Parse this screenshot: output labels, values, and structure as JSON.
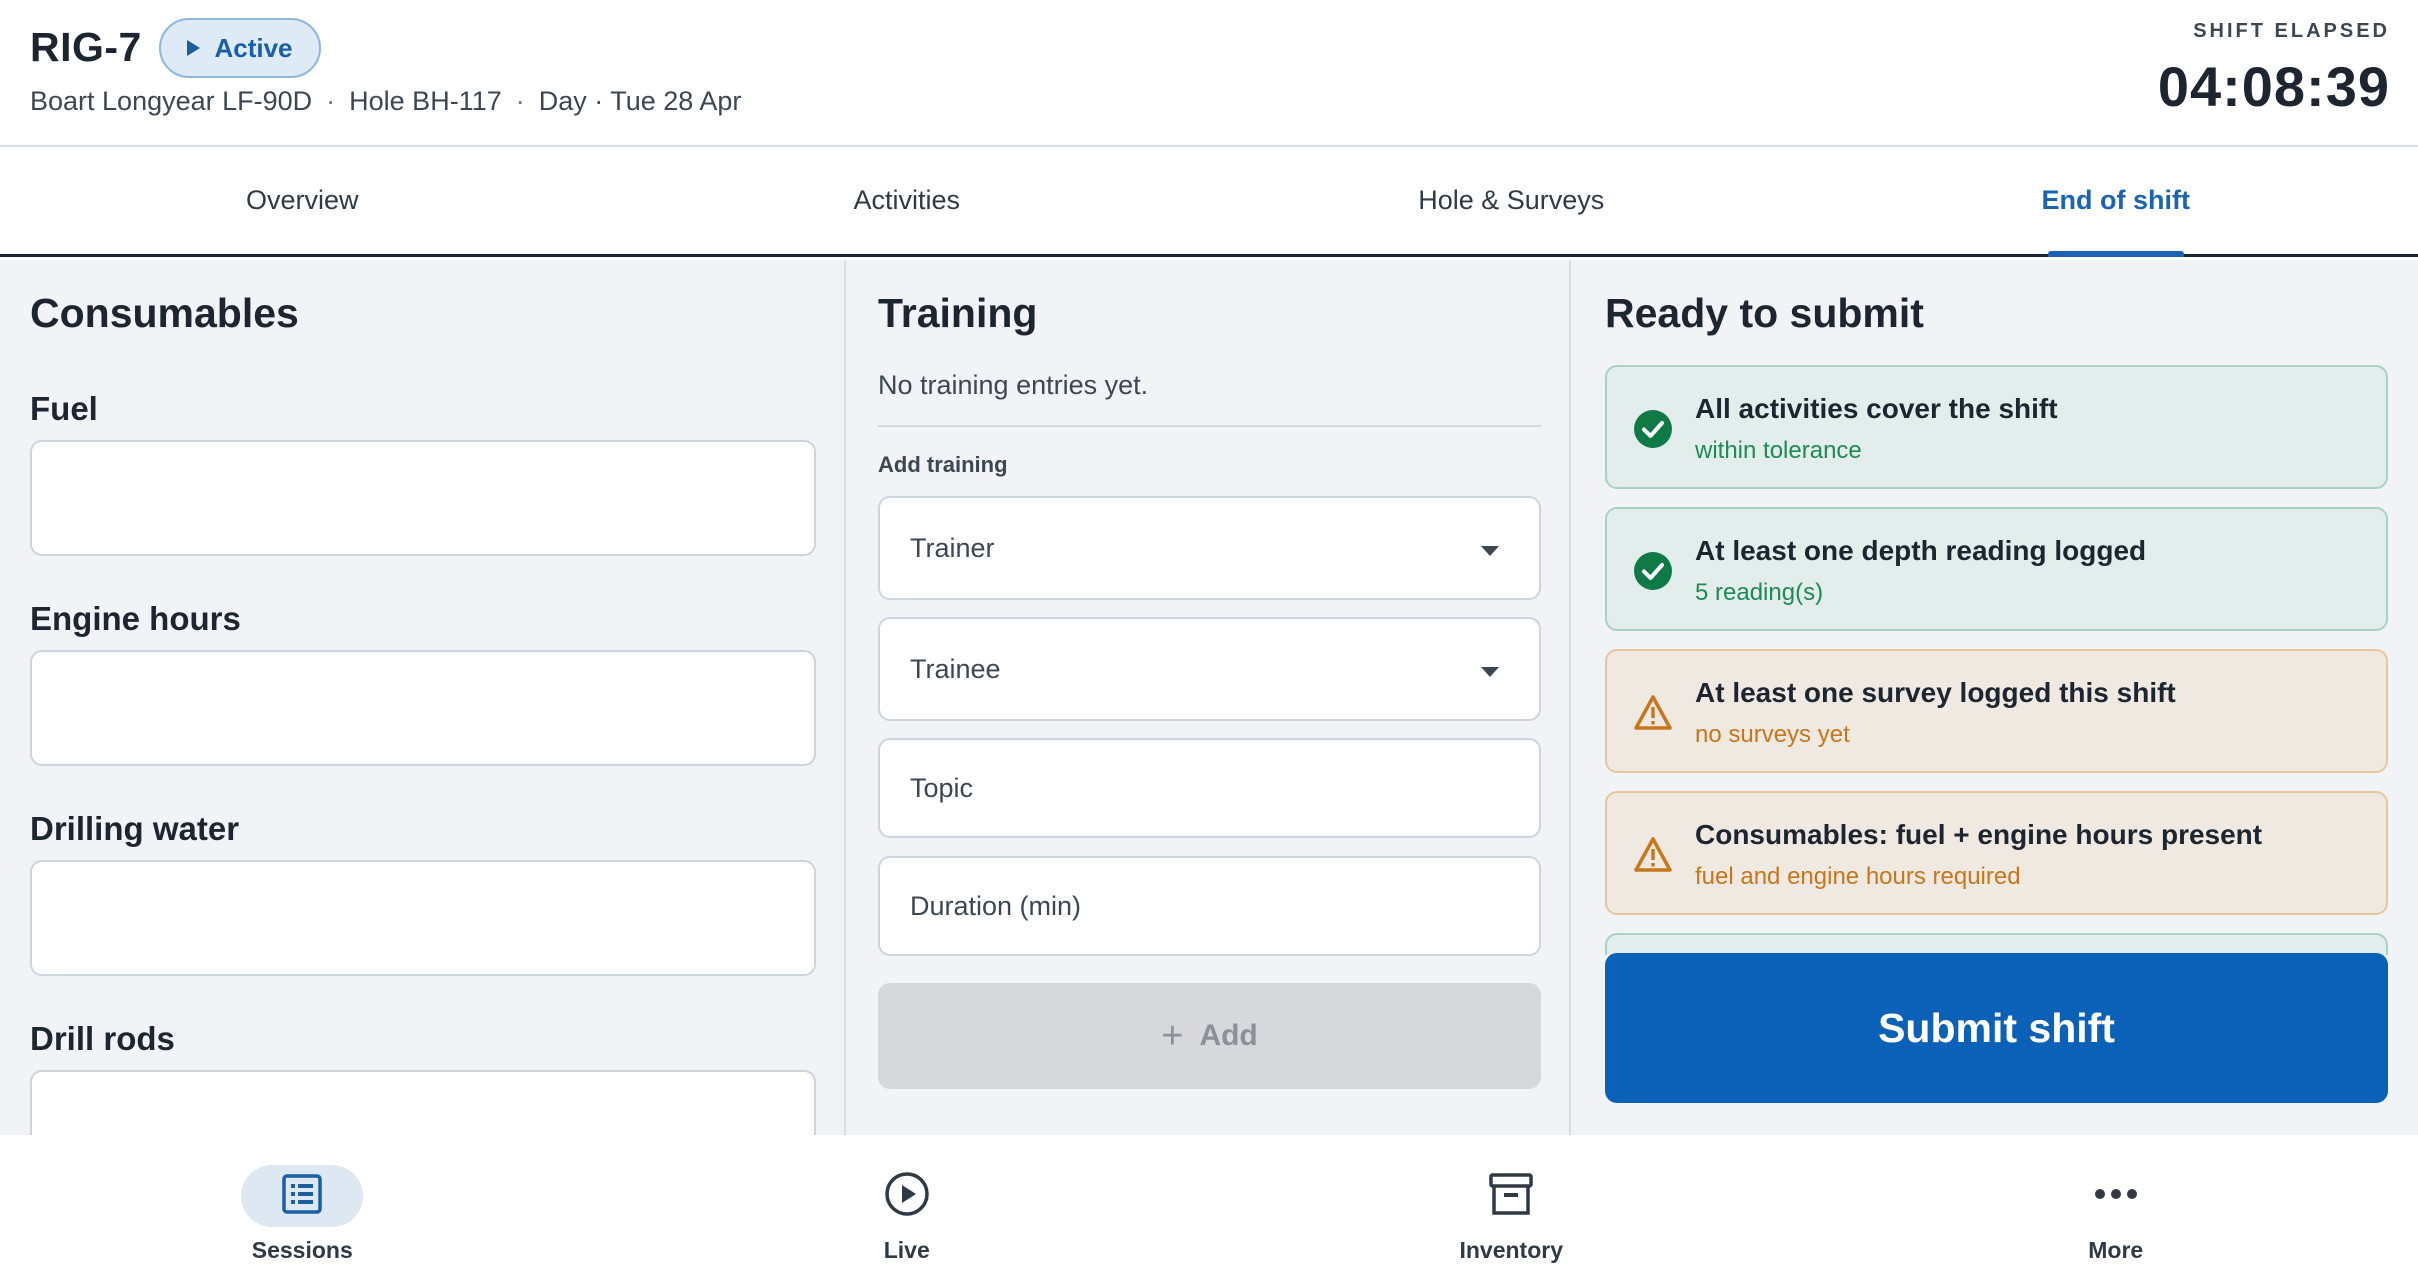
{
  "header": {
    "rig": "RIG-7",
    "status": "Active",
    "machine": "Boart Longyear LF-90D",
    "hole": "Hole BH-117",
    "shift_date": "Day · Tue 28 Apr",
    "separator": "·",
    "elapsed_label": "SHIFT ELAPSED",
    "elapsed_value": "04:08:39"
  },
  "tabs": [
    {
      "label": "Overview",
      "active": false
    },
    {
      "label": "Activities",
      "active": false
    },
    {
      "label": "Hole & Surveys",
      "active": false
    },
    {
      "label": "End of shift",
      "active": true
    }
  ],
  "consumables": {
    "title": "Consumables",
    "fields": [
      {
        "label": "Fuel",
        "value": ""
      },
      {
        "label": "Engine hours",
        "value": ""
      },
      {
        "label": "Drilling water",
        "value": ""
      },
      {
        "label": "Drill rods",
        "value": ""
      }
    ]
  },
  "training": {
    "title": "Training",
    "empty_note": "No training entries yet.",
    "add_label": "Add training",
    "trainer_placeholder": "Trainer",
    "trainee_placeholder": "Trainee",
    "topic_placeholder": "Topic",
    "duration_placeholder": "Duration (min)",
    "add_button": "Add"
  },
  "submit": {
    "title": "Ready to submit",
    "checks": [
      {
        "title": "All activities cover the shift",
        "detail": "within tolerance",
        "status": "ok"
      },
      {
        "title": "At least one depth reading logged",
        "detail": "5 reading(s)",
        "status": "ok"
      },
      {
        "title": "At least one survey logged this shift",
        "detail": "no surveys yet",
        "status": "warn"
      },
      {
        "title": "Consumables: fuel + engine hours present",
        "detail": "fuel and engine hours required",
        "status": "warn"
      }
    ],
    "submit_button": "Submit shift"
  },
  "bottom_nav": [
    {
      "label": "Sessions",
      "icon": "list-icon",
      "active": true
    },
    {
      "label": "Live",
      "icon": "play-circle-icon",
      "active": false
    },
    {
      "label": "Inventory",
      "icon": "archive-box-icon",
      "active": false
    },
    {
      "label": "More",
      "icon": "more-dots-icon",
      "active": false
    }
  ],
  "colors": {
    "accent": "#1a63b5",
    "ok": "#1e8a55",
    "warn": "#c7761a",
    "submit": "#0b61b8"
  }
}
